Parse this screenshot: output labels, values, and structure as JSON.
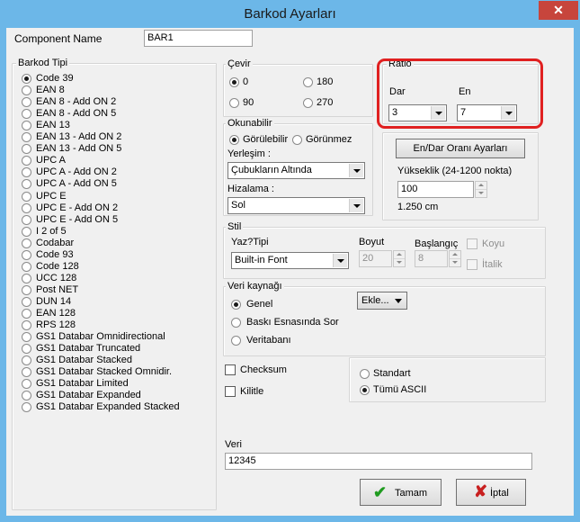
{
  "window": {
    "title": "Barkod Ayarları",
    "close_glyph": "✕"
  },
  "component": {
    "label": "Component Name",
    "value": "BAR1"
  },
  "barkod_tipi": {
    "title": "Barkod Tipi",
    "selected_index": 0,
    "items": [
      "Code 39",
      "EAN 8",
      "EAN 8 - Add ON 2",
      "EAN 8 - Add ON 5",
      "EAN 13",
      "EAN 13 - Add ON 2",
      "EAN 13 - Add ON 5",
      "UPC A",
      "UPC A - Add ON 2",
      "UPC A - Add ON 5",
      "UPC E",
      "UPC E - Add ON 2",
      "UPC E - Add ON 5",
      "I 2 of 5",
      "Codabar",
      "Code 93",
      "Code 128",
      "UCC 128",
      "Post NET",
      "DUN 14",
      "EAN 128",
      "RPS 128",
      "GS1 Databar Omnidirectional",
      "GS1 Databar Truncated",
      "GS1 Databar Stacked",
      "GS1 Databar Stacked Omnidir.",
      "GS1 Databar Limited",
      "GS1 Databar Expanded",
      "GS1 Databar Expanded Stacked"
    ]
  },
  "cevir": {
    "title": "Çevir",
    "options": [
      "0",
      "180",
      "90",
      "270"
    ],
    "selected": "0"
  },
  "ratio": {
    "title": "Ratio",
    "dar_label": "Dar",
    "dar_value": "3",
    "en_label": "En",
    "en_value": "7",
    "highlight_color": "#e02020"
  },
  "okunabilir": {
    "title": "Okunabilir",
    "gorulebilir": "Görülebilir",
    "gorulmez": "Görünmez",
    "yerlesim_label": "Yerleşim :",
    "yerlesim_value": "Çubukların Altında",
    "hizalama_label": "Hizalama :",
    "hizalama_value": "Sol"
  },
  "ratio_panel": {
    "button": "En/Dar Oranı Ayarları",
    "yukseklik_label": "Yükseklik (24-1200 nokta)",
    "yukseklik_value": "100",
    "cm_text": "1.250 cm"
  },
  "stil": {
    "title": "Stil",
    "yazi_tipi_label": "Yaz?Tipi",
    "yazi_tipi_value": "Built-in Font",
    "boyut_label": "Boyut",
    "boyut_value": "20",
    "baslangic_label": "Başlangıç",
    "baslangic_value": "8",
    "koyu": "Koyu",
    "italik": "İtalik"
  },
  "veri_kaynagi": {
    "title": "Veri kaynağı",
    "genel": "Genel",
    "baski": "Baskı Esnasında Sor",
    "veritabani": "Veritabanı",
    "ekle": "Ekle..."
  },
  "checks": {
    "checksum": "Checksum",
    "kilitle": "Kilitle"
  },
  "ascii": {
    "standart": "Standart",
    "tumu": "Tümü ASCII"
  },
  "veri": {
    "label": "Veri",
    "value": "12345"
  },
  "buttons": {
    "tamam": "Tamam",
    "iptal": "İptal",
    "tamam_color": "#1f9b1f",
    "iptal_color": "#c82020"
  }
}
